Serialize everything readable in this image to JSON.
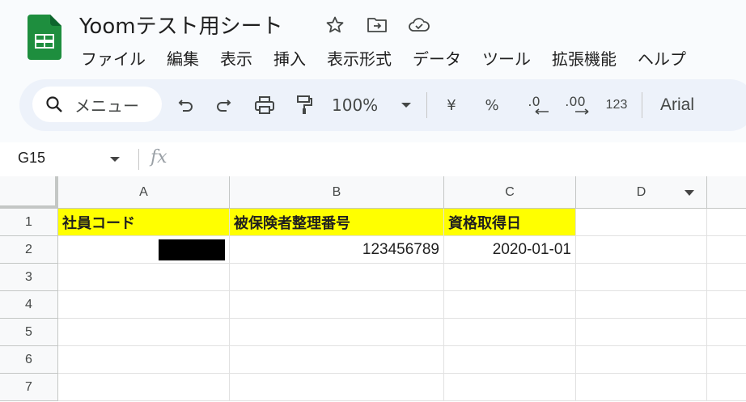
{
  "header": {
    "title": "Yoomテスト用シート",
    "menu": [
      "ファイル",
      "編集",
      "表示",
      "挿入",
      "表示形式",
      "データ",
      "ツール",
      "拡張機能",
      "ヘルプ"
    ]
  },
  "toolbar": {
    "search_label": "メニュー",
    "zoom": "100%",
    "currency": "¥",
    "percent": "%",
    "dec_decrease": ".0",
    "dec_increase": ".00",
    "number_format": "123",
    "font": "Arial"
  },
  "formula_bar": {
    "cell_ref": "G15",
    "fx": "fx"
  },
  "sheet": {
    "columns": [
      "A",
      "B",
      "C",
      "D"
    ],
    "rows": [
      "1",
      "2",
      "3",
      "4",
      "5",
      "6",
      "7"
    ],
    "header_row": [
      "社員コード",
      "被保険者整理番号",
      "資格取得日"
    ],
    "data_row": {
      "employee_code": "",
      "insured_number": "123456789",
      "acquisition_date": "2020-01-01"
    }
  },
  "colors": {
    "header_fill": "#ffff00",
    "sheets_green": "#1e8e3e",
    "toolbar_bg": "#edf2fa"
  }
}
